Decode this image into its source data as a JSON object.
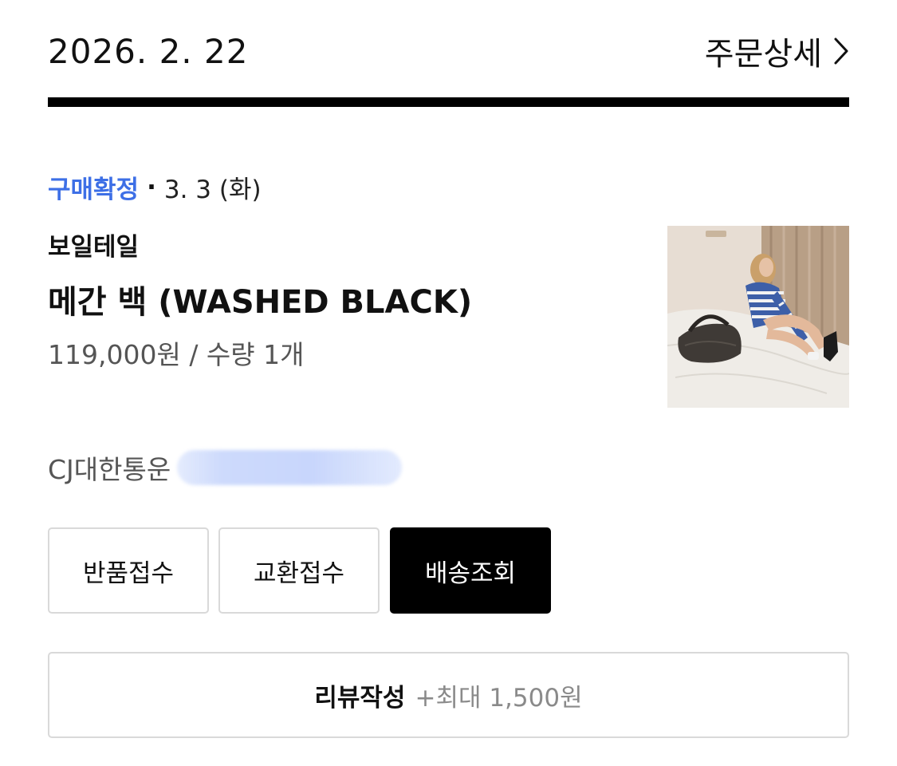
{
  "order": {
    "date": "2026. 2. 22",
    "detail_link_label": "주문상세"
  },
  "status": {
    "label": "구매확정",
    "separator": "·",
    "date": "3. 3 (화)",
    "color": "#3d6fe6"
  },
  "product": {
    "brand": "보일테일",
    "name": "메간 백 (WASHED BLACK)",
    "price_quantity": "119,000원 / 수량 1개",
    "image_icon": "product-photo"
  },
  "delivery": {
    "courier": "CJ대한통운"
  },
  "actions": {
    "return_label": "반품접수",
    "exchange_label": "교환접수",
    "tracking_label": "배송조회"
  },
  "review": {
    "label": "리뷰작성",
    "reward": "+최대 1,500원"
  }
}
